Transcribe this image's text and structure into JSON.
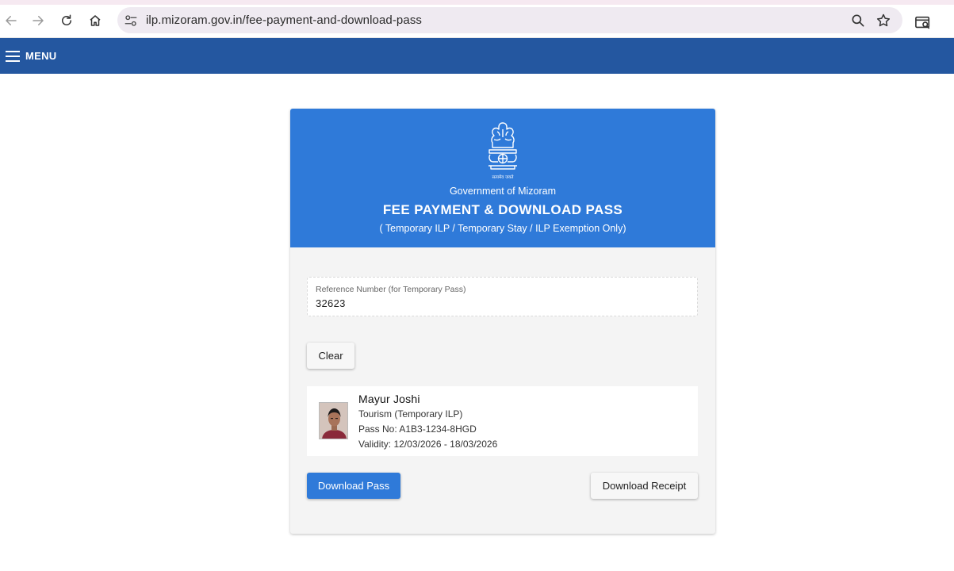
{
  "browser": {
    "url": "ilp.mizoram.gov.in/fee-payment-and-download-pass",
    "icons": [
      "back-icon",
      "forward-icon",
      "reload-icon",
      "home-icon",
      "site-info-icon",
      "zoom-icon",
      "bookmark-star-icon",
      "search-tabs-icon"
    ]
  },
  "menubar": {
    "menu_label": "MENU",
    "background": "#2457a0"
  },
  "header": {
    "emblem_motto": "सत्यमेव जयते",
    "government": "Government of Mizoram",
    "title": "FEE PAYMENT & DOWNLOAD PASS",
    "subtitle": "( Temporary ILP / Temporary Stay / ILP Exemption Only)",
    "background": "#2f7ad9"
  },
  "form": {
    "reference_label": "Reference Number (for Temporary Pass)",
    "reference_value": "32623",
    "clear_label": "Clear"
  },
  "pass": {
    "name": "Mayur Joshi",
    "type": "Tourism (Temporary ILP)",
    "pass_no": "Pass No: A1B3-1234-8HGD",
    "validity": "Validity: 12/03/2026 - 18/03/2026"
  },
  "actions": {
    "download_pass_label": "Download Pass",
    "download_receipt_label": "Download Receipt"
  }
}
